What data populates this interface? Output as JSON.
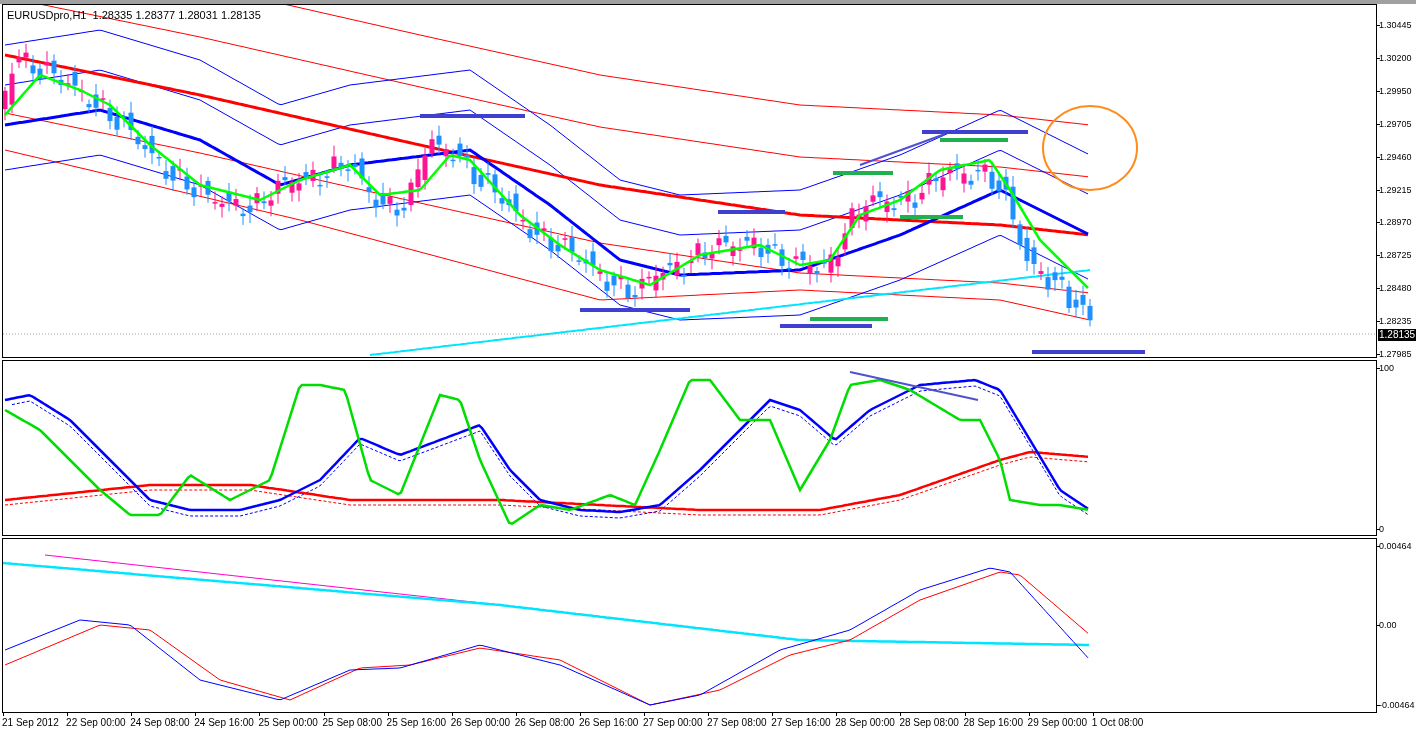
{
  "price_panel": {
    "header": "EURUSDpro,H1  1.28335 1.28377 1.28031 1.28135",
    "price_labels": [
      "1.30445",
      "1.30200",
      "1.29950",
      "1.29705",
      "1.29460",
      "1.29215",
      "1.28970",
      "1.28725",
      "1.28480",
      "1.28235",
      "1.27985"
    ],
    "current_price": "1.28135"
  },
  "oscillator_panel": {
    "scale_labels": [
      "100",
      "0"
    ]
  },
  "macd_panel": {
    "scale_labels": [
      "0.00464",
      "0.00",
      "-0.00464"
    ]
  },
  "time_axis": {
    "labels": [
      "21 Sep 2012",
      "22 Sep 00:00",
      "24 Sep 08:00",
      "24 Sep 16:00",
      "25 Sep 00:00",
      "25 Sep 08:00",
      "25 Sep 16:00",
      "26 Sep 00:00",
      "26 Sep 08:00",
      "26 Sep 16:00",
      "27 Sep 00:00",
      "27 Sep 08:00",
      "27 Sep 16:00",
      "28 Sep 00:00",
      "28 Sep 08:00",
      "28 Sep 16:00",
      "29 Sep 00:00",
      "1 Oct 08:00"
    ]
  }
}
